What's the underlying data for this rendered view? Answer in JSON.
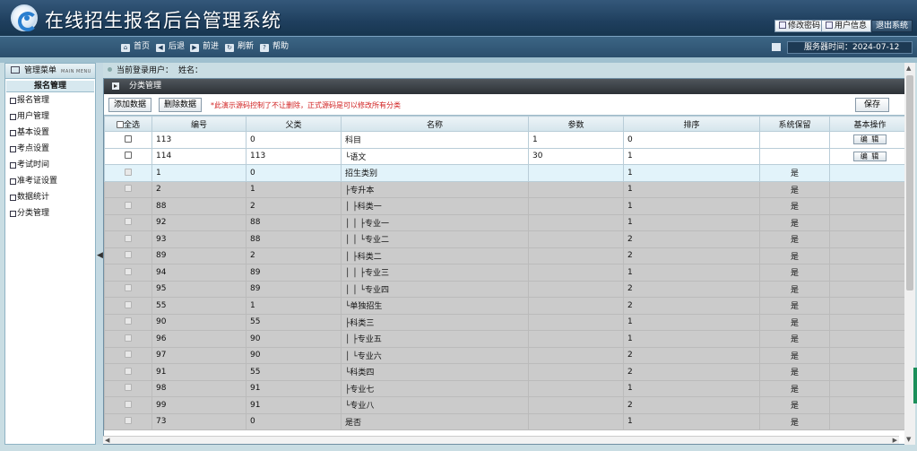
{
  "app": {
    "title": "在线招生报名后台管理系统",
    "header_buttons": [
      "修改密码",
      "用户信息",
      "退出系统"
    ]
  },
  "nav": {
    "items": [
      "首页",
      "后退",
      "前进",
      "刷新",
      "帮助"
    ],
    "server_time": "服务器时间：2024-07-12"
  },
  "sidebar": {
    "title": "管理菜单",
    "title_en": "MAIN MENU",
    "section": "报名管理",
    "items": [
      "报名管理",
      "用户管理",
      "基本设置",
      "考点设置",
      "考试时间",
      "准考证设置",
      "数据统计",
      "分类管理"
    ]
  },
  "userbar": {
    "label": "当前登录用户：",
    "name_label": "姓名："
  },
  "panel": {
    "title": "分类管理",
    "add_button": "添加数据",
    "delete_button": "删除数据",
    "tip": "*此演示源码控制了不让删除，正式源码是可以修改所有分类",
    "save_button": "保存"
  },
  "table": {
    "headers": [
      "全选",
      "编号",
      "父类",
      "名称",
      "参数",
      "排序",
      "系统保留",
      "基本操作"
    ],
    "edit_label": "编 辑",
    "rows": [
      {
        "id": "113",
        "parent": "0",
        "name": "科目",
        "param": "1",
        "order": "0",
        "reserved": "",
        "edit": true,
        "state": "white"
      },
      {
        "id": "114",
        "parent": "113",
        "name": "└语文",
        "param": "30",
        "order": "1",
        "reserved": "",
        "edit": true,
        "state": "white"
      },
      {
        "id": "1",
        "parent": "0",
        "name": "招生类别",
        "param": "",
        "order": "1",
        "reserved": "是",
        "edit": false,
        "state": "blue"
      },
      {
        "id": "2",
        "parent": "1",
        "name": "├专升本",
        "param": "",
        "order": "1",
        "reserved": "是",
        "edit": false,
        "state": "grey"
      },
      {
        "id": "88",
        "parent": "2",
        "name": "│ ├科类一",
        "param": "",
        "order": "1",
        "reserved": "是",
        "edit": false,
        "state": "grey"
      },
      {
        "id": "92",
        "parent": "88",
        "name": "│ │ ├专业一",
        "param": "",
        "order": "1",
        "reserved": "是",
        "edit": false,
        "state": "grey"
      },
      {
        "id": "93",
        "parent": "88",
        "name": "│ │ └专业二",
        "param": "",
        "order": "2",
        "reserved": "是",
        "edit": false,
        "state": "grey"
      },
      {
        "id": "89",
        "parent": "2",
        "name": "│ ├科类二",
        "param": "",
        "order": "2",
        "reserved": "是",
        "edit": false,
        "state": "grey"
      },
      {
        "id": "94",
        "parent": "89",
        "name": "│ │ ├专业三",
        "param": "",
        "order": "1",
        "reserved": "是",
        "edit": false,
        "state": "grey"
      },
      {
        "id": "95",
        "parent": "89",
        "name": "│ │ └专业四",
        "param": "",
        "order": "2",
        "reserved": "是",
        "edit": false,
        "state": "grey"
      },
      {
        "id": "55",
        "parent": "1",
        "name": "└单独招生",
        "param": "",
        "order": "2",
        "reserved": "是",
        "edit": false,
        "state": "grey"
      },
      {
        "id": "90",
        "parent": "55",
        "name": "├科类三",
        "param": "",
        "order": "1",
        "reserved": "是",
        "edit": false,
        "state": "grey"
      },
      {
        "id": "96",
        "parent": "90",
        "name": "│ ├专业五",
        "param": "",
        "order": "1",
        "reserved": "是",
        "edit": false,
        "state": "grey"
      },
      {
        "id": "97",
        "parent": "90",
        "name": "│ └专业六",
        "param": "",
        "order": "2",
        "reserved": "是",
        "edit": false,
        "state": "grey"
      },
      {
        "id": "91",
        "parent": "55",
        "name": "└科类四",
        "param": "",
        "order": "2",
        "reserved": "是",
        "edit": false,
        "state": "grey"
      },
      {
        "id": "98",
        "parent": "91",
        "name": "├专业七",
        "param": "",
        "order": "1",
        "reserved": "是",
        "edit": false,
        "state": "grey"
      },
      {
        "id": "99",
        "parent": "91",
        "name": "└专业八",
        "param": "",
        "order": "2",
        "reserved": "是",
        "edit": false,
        "state": "grey"
      },
      {
        "id": "73",
        "parent": "0",
        "name": "是否",
        "param": "",
        "order": "1",
        "reserved": "是",
        "edit": false,
        "state": "grey"
      }
    ]
  },
  "colors": {
    "header": "#1f3f5e",
    "nav": "#2b4f6d",
    "tip": "#d01e1e",
    "row_locked": "#cbcbcb",
    "row_highlight": "#e2f3fa"
  }
}
